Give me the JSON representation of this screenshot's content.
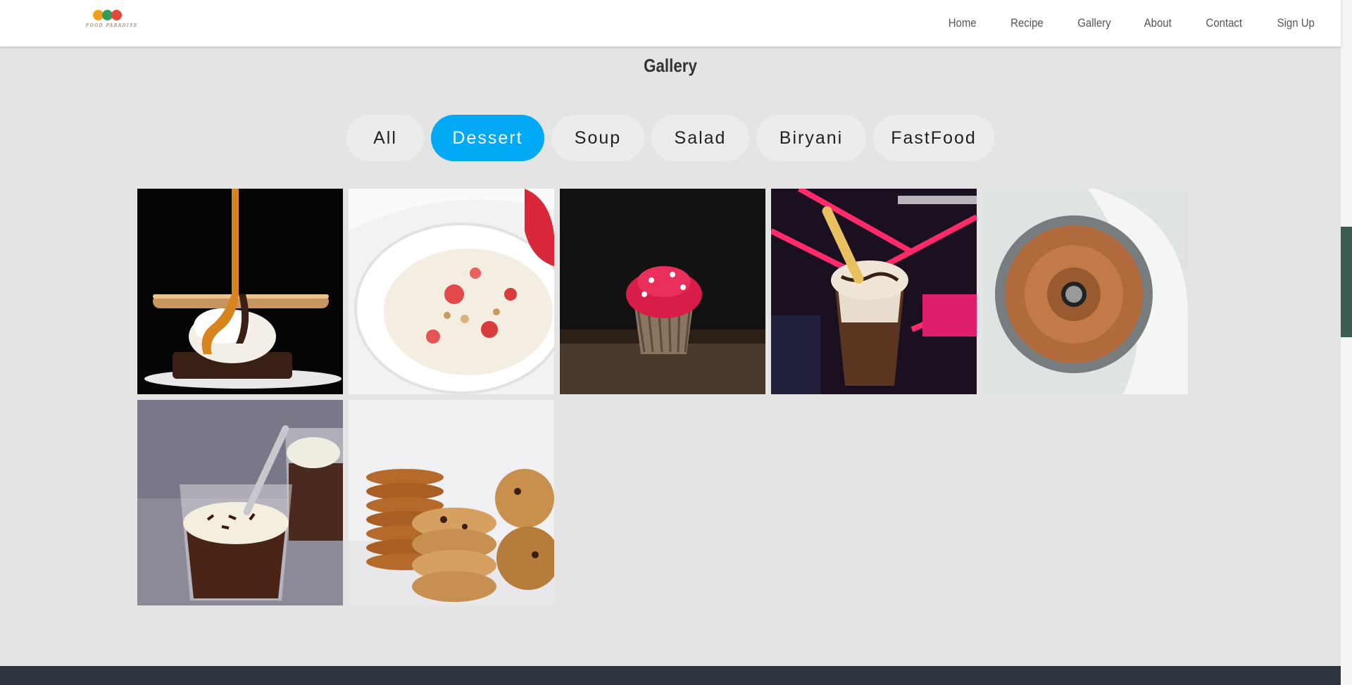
{
  "brand": {
    "name": "FOOD PARADISE"
  },
  "nav": {
    "items": [
      "Home",
      "Recipe",
      "Gallery",
      "About",
      "Contact",
      "Sign Up"
    ]
  },
  "gallery": {
    "title": "Gallery",
    "filters": [
      "All",
      "Dessert",
      "Soup",
      "Salad",
      "Biryani",
      "FastFood"
    ],
    "active_filter": "Dessert",
    "images": [
      "caramel-ice-cream-brownie",
      "strawberry-oat-yogurt-bowl",
      "red-frosted-cupcake",
      "chocolate-milkshake",
      "bundt-cake",
      "chocolate-cream-pudding-cups",
      "stacked-cookies"
    ]
  },
  "colors": {
    "accent": "#03a9f4",
    "background": "#e4e4e4",
    "footer": "#2e3440",
    "scroll_thumb": "#3d5c52"
  }
}
